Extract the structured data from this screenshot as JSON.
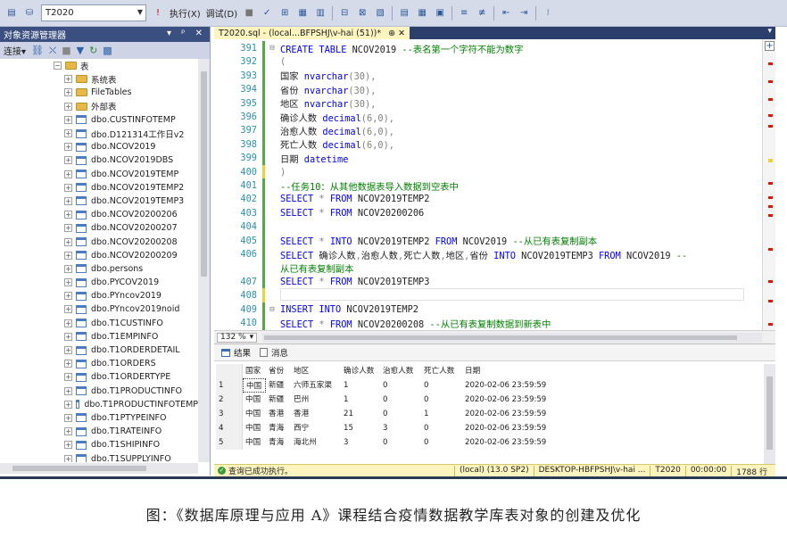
{
  "toolbar": {
    "database": "T2020",
    "execute_label": "执行(X)",
    "debug_label": "调试(D)"
  },
  "explorer": {
    "title": "对象资源管理器",
    "controls": "▾ ᵖ ✕",
    "connect_label": "连接▾",
    "tree": [
      {
        "label": "表",
        "indent": 60,
        "kind": "folder",
        "expand": "−"
      },
      {
        "label": "系统表",
        "indent": 72,
        "kind": "folder",
        "expand": "+"
      },
      {
        "label": "FileTables",
        "indent": 72,
        "kind": "folder",
        "expand": "+"
      },
      {
        "label": "外部表",
        "indent": 72,
        "kind": "folder",
        "expand": "+"
      },
      {
        "label": "dbo.CUSTINFOTEMP",
        "indent": 72,
        "kind": "table",
        "expand": "+"
      },
      {
        "label": "dbo.D121314工作日v2",
        "indent": 72,
        "kind": "table",
        "expand": "+"
      },
      {
        "label": "dbo.NCOV2019",
        "indent": 72,
        "kind": "table",
        "expand": "+"
      },
      {
        "label": "dbo.NCOV2019DBS",
        "indent": 72,
        "kind": "table",
        "expand": "+"
      },
      {
        "label": "dbo.NCOV2019TEMP",
        "indent": 72,
        "kind": "table",
        "expand": "+"
      },
      {
        "label": "dbo.NCOV2019TEMP2",
        "indent": 72,
        "kind": "table",
        "expand": "+"
      },
      {
        "label": "dbo.NCOV2019TEMP3",
        "indent": 72,
        "kind": "table",
        "expand": "+"
      },
      {
        "label": "dbo.NCOV20200206",
        "indent": 72,
        "kind": "table",
        "expand": "+"
      },
      {
        "label": "dbo.NCOV20200207",
        "indent": 72,
        "kind": "table",
        "expand": "+"
      },
      {
        "label": "dbo.NCOV20200208",
        "indent": 72,
        "kind": "table",
        "expand": "+"
      },
      {
        "label": "dbo.NCOV20200209",
        "indent": 72,
        "kind": "table",
        "expand": "+"
      },
      {
        "label": "dbo.persons",
        "indent": 72,
        "kind": "table",
        "expand": "+"
      },
      {
        "label": "dbo.PYCOV2019",
        "indent": 72,
        "kind": "table",
        "expand": "+"
      },
      {
        "label": "dbo.PYncov2019",
        "indent": 72,
        "kind": "table",
        "expand": "+"
      },
      {
        "label": "dbo.PYncov2019noid",
        "indent": 72,
        "kind": "table",
        "expand": "+"
      },
      {
        "label": "dbo.T1CUSTINFO",
        "indent": 72,
        "kind": "table",
        "expand": "+"
      },
      {
        "label": "dbo.T1EMPINFO",
        "indent": 72,
        "kind": "table",
        "expand": "+"
      },
      {
        "label": "dbo.T1ORDERDETAIL",
        "indent": 72,
        "kind": "table",
        "expand": "+"
      },
      {
        "label": "dbo.T1ORDERS",
        "indent": 72,
        "kind": "table",
        "expand": "+"
      },
      {
        "label": "dbo.T1ORDERTYPE",
        "indent": 72,
        "kind": "table",
        "expand": "+"
      },
      {
        "label": "dbo.T1PRODUCTINFO",
        "indent": 72,
        "kind": "table",
        "expand": "+"
      },
      {
        "label": "dbo.T1PRODUCTINFOTEMP",
        "indent": 72,
        "kind": "table",
        "expand": "+"
      },
      {
        "label": "dbo.T1PTYPEINFO",
        "indent": 72,
        "kind": "table",
        "expand": "+"
      },
      {
        "label": "dbo.T1RATEINFO",
        "indent": 72,
        "kind": "table",
        "expand": "+"
      },
      {
        "label": "dbo.T1SHIPINFO",
        "indent": 72,
        "kind": "table",
        "expand": "+"
      },
      {
        "label": "dbo.T1SUPPLYINFO",
        "indent": 72,
        "kind": "table",
        "expand": "+"
      }
    ]
  },
  "editor": {
    "tab_title": "T2020.sql - (local...BFPSHJ\\v-hai (51))*",
    "tab_pin": "⊕ ✕",
    "zoom": "132 %",
    "lines": [
      {
        "n": "391",
        "fold": "⊟",
        "bar": "green",
        "html": "<span class='kw'>CREATE TABLE</span> <span class='sq'>NCOV2019</span>  <span class='cm'>--表名第一个字符不能为数字</span>"
      },
      {
        "n": "392",
        "fold": "",
        "bar": "green",
        "html": "<span class='gr'>(</span>"
      },
      {
        "n": "393",
        "fold": "",
        "bar": "green",
        "html": "    国家 <span class='tp'>nvarchar</span><span class='gr'>(30),</span>"
      },
      {
        "n": "394",
        "fold": "",
        "bar": "green",
        "html": "    省份 <span class='tp'>nvarchar</span><span class='gr'>(30),</span>"
      },
      {
        "n": "395",
        "fold": "",
        "bar": "green",
        "html": "    地区 <span class='tp'>nvarchar</span><span class='gr'>(30),</span>"
      },
      {
        "n": "396",
        "fold": "",
        "bar": "green",
        "html": "    确诊人数 <span class='tp'>decimal</span><span class='gr'>(6,0),</span>"
      },
      {
        "n": "397",
        "fold": "",
        "bar": "green",
        "html": "    治愈人数 <span class='tp'>decimal</span><span class='gr'>(6,0),</span>"
      },
      {
        "n": "398",
        "fold": "",
        "bar": "green",
        "html": "    死亡人数 <span class='tp'>decimal</span><span class='gr'>(6,0),</span>"
      },
      {
        "n": "399",
        "fold": "",
        "bar": "green",
        "html": "    日期 <span class='tp'>datetime</span>"
      },
      {
        "n": "400",
        "fold": "",
        "bar": "yellow",
        "html": "<span class='gr'>)</span>"
      },
      {
        "n": "401",
        "fold": "",
        "bar": "green",
        "html": "<span class='cm'>--任务10：从其他数据表导入数据到空表中</span>"
      },
      {
        "n": "402",
        "fold": "",
        "bar": "green",
        "html": "<span class='kw'>SELECT</span> <span class='gr'>*</span> <span class='kw'>FROM</span> NCOV2019TEMP2"
      },
      {
        "n": "403",
        "fold": "",
        "bar": "green",
        "html": "<span class='kw'>SELECT</span> <span class='gr'>*</span> <span class='kw'>FROM</span> NCOV20200206"
      },
      {
        "n": "404",
        "fold": "",
        "bar": "green",
        "html": ""
      },
      {
        "n": "405",
        "fold": "",
        "bar": "green",
        "html": "<span class='kw'>SELECT</span> <span class='gr'>*</span> <span class='kw'>INTO</span> NCOV2019TEMP2 <span class='kw'>FROM</span> NCOV2019   <span class='cm'>--从已有表复制副本</span>"
      },
      {
        "n": "406",
        "fold": "",
        "bar": "green",
        "html": "<span class='kw'>SELECT</span> 确诊人数<span class='gr'>,</span>治愈人数<span class='gr'>,</span>死亡人数<span class='gr'>,</span>地区<span class='gr'>,</span>省份 <span class='kw'>INTO</span> NCOV2019TEMP3 <span class='kw'>FROM</span> NCOV2019   <span class='cm'>--</span>"
      },
      {
        "n": "",
        "fold": "",
        "bar": "green",
        "html": "  <span class='cm'>从已有表复制副本</span>"
      },
      {
        "n": "407",
        "fold": "",
        "bar": "green",
        "html": "<span class='kw'>SELECT</span> <span class='gr'>*</span> <span class='kw'>FROM</span> NCOV2019TEMP3"
      },
      {
        "n": "408",
        "fold": "",
        "bar": "yellow",
        "html": "<span class='cur'></span>"
      },
      {
        "n": "409",
        "fold": "⊟",
        "bar": "green",
        "html": "<span class='kw'>INSERT INTO</span>  NCOV2019TEMP2"
      },
      {
        "n": "410",
        "fold": "",
        "bar": "green",
        "html": "<span class='kw'>SELECT</span> <span class='gr'>*</span>  <span class='kw'>FROM</span> NCOV20200208   <span class='cm'>--从已有表复制数据到新表中</span>"
      }
    ]
  },
  "results": {
    "tab_results": "结果",
    "tab_messages": "消息",
    "columns": [
      "国家",
      "省份",
      "地区",
      "确诊人数",
      "治愈人数",
      "死亡人数",
      "日期"
    ],
    "rows": [
      [
        "1",
        "中国",
        "新疆",
        "六师五家渠",
        "1",
        "0",
        "0",
        "2020-02-06 23:59:59"
      ],
      [
        "2",
        "中国",
        "新疆",
        "巴州",
        "1",
        "0",
        "0",
        "2020-02-06 23:59:59"
      ],
      [
        "3",
        "中国",
        "香港",
        "香港",
        "21",
        "0",
        "1",
        "2020-02-06 23:59:59"
      ],
      [
        "4",
        "中国",
        "青海",
        "西宁",
        "15",
        "3",
        "0",
        "2020-02-06 23:59:59"
      ],
      [
        "5",
        "中国",
        "青海",
        "海北州",
        "3",
        "0",
        "0",
        "2020-02-06 23:59:59"
      ]
    ]
  },
  "status": {
    "message": "查询已成功执行。",
    "server": "(local) (13.0 SP2)",
    "machine": "DESKTOP-HBFPSHJ\\v-hai ...",
    "database": "T2020",
    "elapsed": "00:00:00",
    "rows": "1788 行"
  },
  "caption": "图：《数据库原理与应用 A》课程结合疫情数据教学库表对象的创建及优化",
  "colors": {
    "title_bar": "#3b4f81",
    "tab_active": "#fdf4bf",
    "keyword": "#0000ff",
    "comment": "#008000",
    "line_number": "#2b91af",
    "error_mark": "#e51400"
  }
}
